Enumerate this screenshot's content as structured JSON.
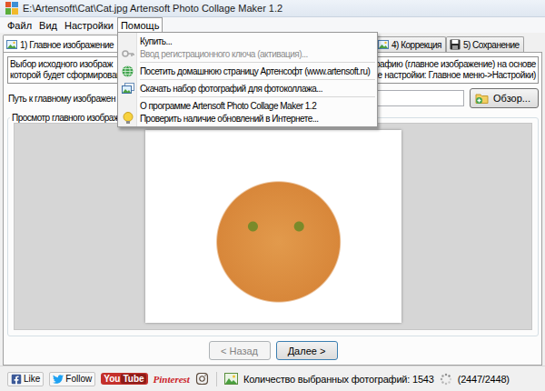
{
  "window": {
    "title": "E:\\Artensoft\\Cat\\Cat.jpg Artensoft Photo Collage Maker 1.2"
  },
  "menu_bar": [
    {
      "label": "Файл",
      "selected": false
    },
    {
      "label": "Вид",
      "selected": false
    },
    {
      "label": "Настройки",
      "selected": false
    },
    {
      "label": "Помощь",
      "selected": true
    }
  ],
  "help_menu": {
    "items": [
      {
        "kind": "item",
        "label": "Купить...",
        "disabled": false
      },
      {
        "kind": "item",
        "label": "Ввод регистрационного ключа (активация)...",
        "disabled": true
      },
      {
        "kind": "separator"
      },
      {
        "kind": "item",
        "label": "Посетить домашнюю страницу Артенсофт (www.artensoft.ru)",
        "disabled": false
      },
      {
        "kind": "separator"
      },
      {
        "kind": "item",
        "label": "Скачать набор фотографий для фотоколлажа...",
        "disabled": false
      },
      {
        "kind": "separator"
      },
      {
        "kind": "item",
        "label": "О программе Artensoft Photo Collage Maker 1.2",
        "disabled": false
      },
      {
        "kind": "item",
        "label": "Проверить наличие обновлений в Интернете...",
        "disabled": false
      }
    ]
  },
  "tabs": [
    {
      "label": "1) Главное изображение",
      "selected": true
    },
    {
      "label": "4) Коррекция",
      "selected": false
    },
    {
      "label": "5) Сохранение",
      "selected": false
    }
  ],
  "description": {
    "lines": [
      {
        "left": "Выбор исходного изображ",
        "right": "фотографию (главное изображение) на основе"
      },
      {
        "left": "которой будет сформирован",
        "right": "основные настройки: Главное меню->Настройки)"
      }
    ]
  },
  "path": {
    "label": "Путь к главному изображен",
    "value": "",
    "button": "Обзор..."
  },
  "preview": {
    "label": "Просмотр главного изображ"
  },
  "navigation": [
    {
      "label": "< Назад",
      "disabled": true
    },
    {
      "label": "Далее >",
      "disabled": false
    }
  ],
  "status_bar": {
    "social": [
      {
        "kind": "facebook",
        "label": "Like"
      },
      {
        "kind": "twitter",
        "label": "Follow"
      },
      {
        "kind": "youtube",
        "parts": [
          "You",
          "Tube"
        ]
      },
      {
        "kind": "pinterest",
        "label": "Pinterest"
      },
      {
        "kind": "instagram"
      }
    ],
    "count": "Количество выбранных фотографий: 1543",
    "progress": "(2447/2448)"
  }
}
